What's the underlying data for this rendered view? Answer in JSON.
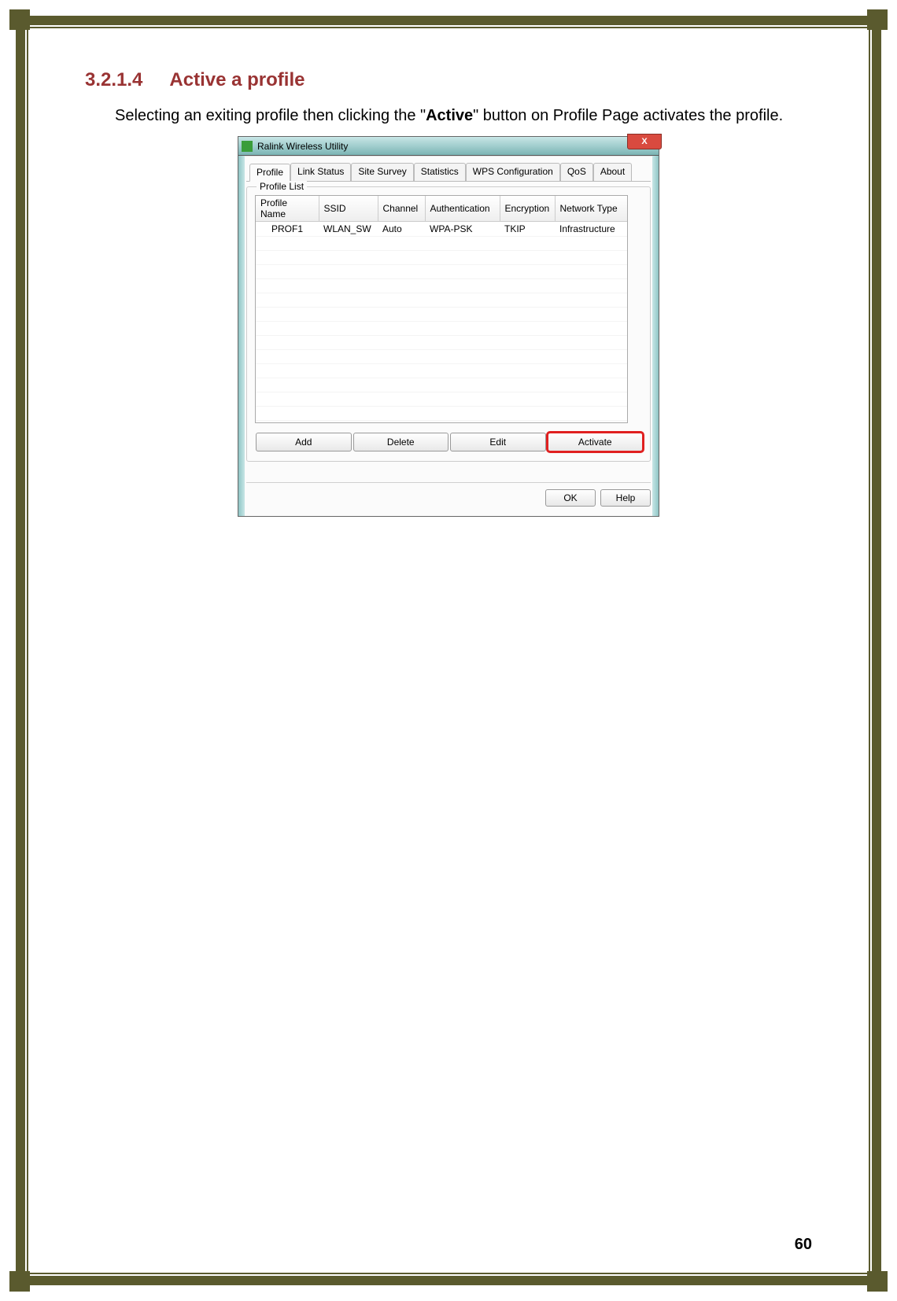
{
  "section": {
    "number": "3.2.1.4",
    "title": "Active a profile",
    "body_prefix": "Selecting an exiting profile then clicking the \"",
    "body_bold": "Active",
    "body_suffix": "\" button on Profile Page activates the profile."
  },
  "page_number": "60",
  "window": {
    "title": "Ralink Wireless Utility",
    "close_label": "X",
    "tabs": [
      "Profile",
      "Link Status",
      "Site Survey",
      "Statistics",
      "WPS Configuration",
      "QoS",
      "About"
    ],
    "fieldset_label": "Profile List",
    "columns": [
      "Profile Name",
      "SSID",
      "Channel",
      "Authentication",
      "Encryption",
      "Network Type"
    ],
    "rows": [
      {
        "profile_name": "PROF1",
        "ssid": "WLAN_SW",
        "channel": "Auto",
        "authentication": "WPA-PSK",
        "encryption": "TKIP",
        "network_type": "Infrastructure"
      }
    ],
    "buttons": {
      "add": "Add",
      "delete": "Delete",
      "edit": "Edit",
      "activate": "Activate"
    },
    "dialog_buttons": {
      "ok": "OK",
      "help": "Help"
    }
  }
}
